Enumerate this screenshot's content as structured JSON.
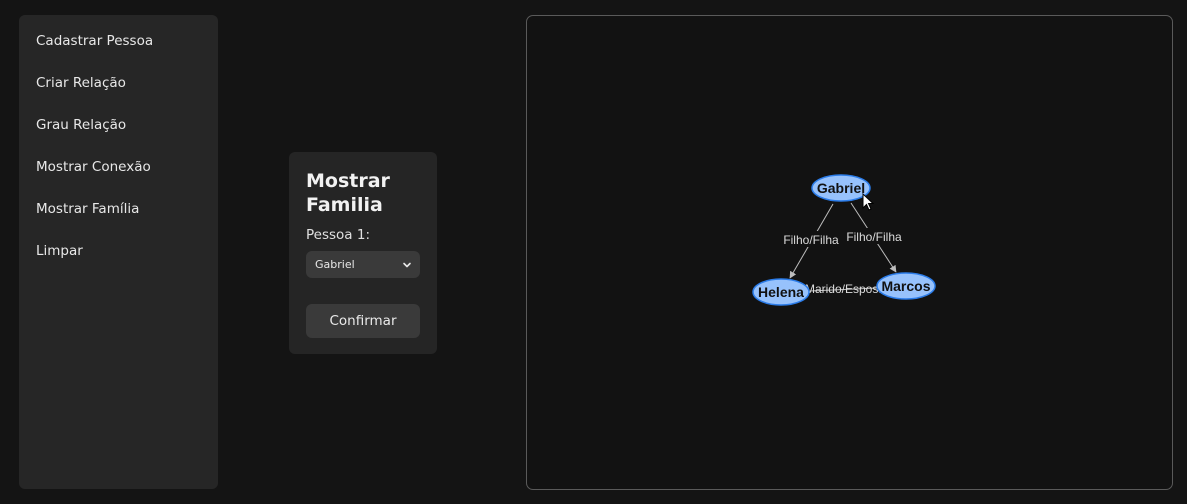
{
  "sidebar": {
    "items": [
      {
        "label": "Cadastrar Pessoa"
      },
      {
        "label": "Criar Relação"
      },
      {
        "label": "Grau Relação"
      },
      {
        "label": "Mostrar Conexão"
      },
      {
        "label": "Mostrar Família"
      },
      {
        "label": "Limpar"
      }
    ]
  },
  "form": {
    "title": "Mostrar Familia",
    "person_label": "Pessoa 1:",
    "person_select_value": "Gabriel",
    "confirm_label": "Confirmar"
  },
  "graph": {
    "nodes": [
      {
        "id": "gabriel",
        "label": "Gabriel"
      },
      {
        "id": "helena",
        "label": "Helena"
      },
      {
        "id": "marcos",
        "label": "Marcos"
      }
    ],
    "edges": [
      {
        "from": "gabriel",
        "to": "helena",
        "label": "Filho/Filha"
      },
      {
        "from": "gabriel",
        "to": "marcos",
        "label": "Filho/Filha"
      },
      {
        "from": "helena",
        "to": "marcos",
        "label": "Marido/Esposa"
      }
    ],
    "colors": {
      "node_fill": "#97c2fc",
      "node_border": "#2b7ce9",
      "edge": "#bdbdbd"
    }
  }
}
